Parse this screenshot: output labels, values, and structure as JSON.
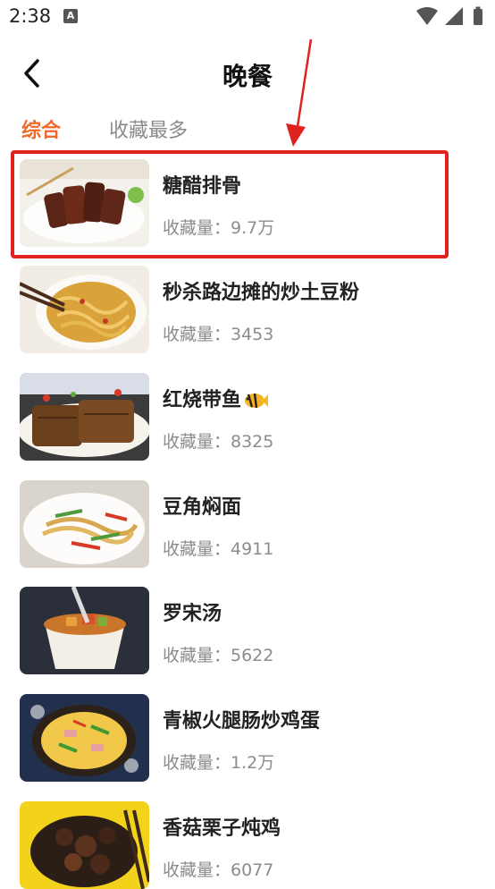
{
  "status_bar": {
    "time": "2:38",
    "app_icon_letter": "A"
  },
  "header": {
    "title": "晚餐",
    "back_icon": "chevron-left-icon"
  },
  "tabs": [
    {
      "label": "综合",
      "active": true
    },
    {
      "label": "收藏最多",
      "active": false
    }
  ],
  "recipes": [
    {
      "title": "糖醋排骨",
      "count": "收藏量：9.7万",
      "highlighted": true
    },
    {
      "title": "秒杀路边摊的炒土豆粉",
      "count": "收藏量：3453"
    },
    {
      "title": "红烧带鱼",
      "count": "收藏量：8325",
      "title_icon": "fish-icon"
    },
    {
      "title": "豆角焖面",
      "count": "收藏量：4911"
    },
    {
      "title": "罗宋汤",
      "count": "收藏量：5622"
    },
    {
      "title": "青椒火腿肠炒鸡蛋",
      "count": "收藏量：1.2万"
    },
    {
      "title": "香菇栗子炖鸡",
      "count": "收藏量：6077"
    }
  ],
  "colors": {
    "accent": "#ee6a2b",
    "highlight": "#e0221f"
  }
}
